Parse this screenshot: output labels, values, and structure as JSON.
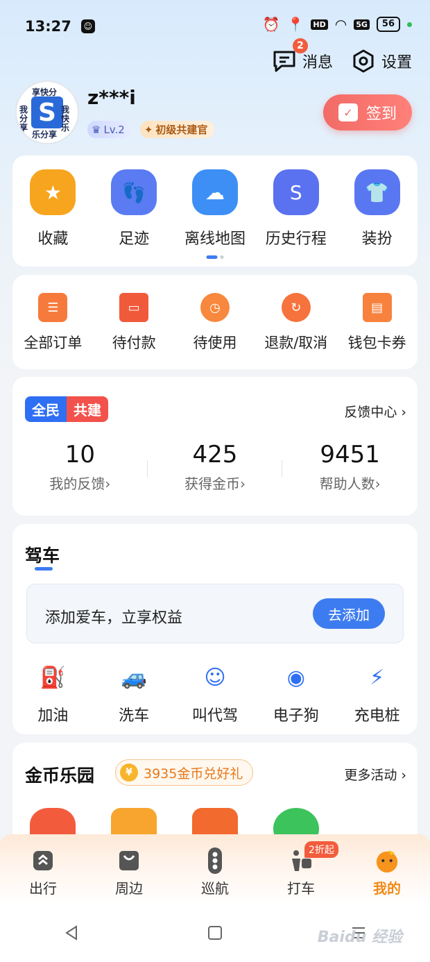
{
  "status": {
    "time": "13:27",
    "battery": "56",
    "network": "5G",
    "hd": "HD"
  },
  "header": {
    "messages_label": "消息",
    "messages_badge": "2",
    "settings_label": "设置"
  },
  "profile": {
    "username": "z***i",
    "level": "Lv.2",
    "title_badge": "初级共建官",
    "signin_label": "签到",
    "avatar_text": [
      "享快分",
      "我分享",
      "我快乐",
      "乐分享"
    ]
  },
  "quick": [
    {
      "label": "收藏",
      "icon": "star-icon",
      "color": "#f7a51e"
    },
    {
      "label": "足迹",
      "icon": "footprint-icon",
      "color": "#5b7bf2"
    },
    {
      "label": "离线地图",
      "icon": "cloud-download-icon",
      "color": "#3d8ff5"
    },
    {
      "label": "历史行程",
      "icon": "route-icon",
      "color": "#5a72f0"
    },
    {
      "label": "装扮",
      "icon": "tshirt-icon",
      "color": "#5a77f2"
    }
  ],
  "orders": [
    {
      "label": "全部订单",
      "icon": "order-list-icon"
    },
    {
      "label": "待付款",
      "icon": "wallet-pay-icon"
    },
    {
      "label": "待使用",
      "icon": "clock-icon"
    },
    {
      "label": "退款/取消",
      "icon": "refund-icon"
    },
    {
      "label": "钱包卡券",
      "icon": "card-coupon-icon"
    }
  ],
  "feedback": {
    "tag_a": "全民",
    "tag_b": "共建",
    "center_label": "反馈中心 ›",
    "stats": [
      {
        "value": "10",
        "label": "我的反馈›"
      },
      {
        "value": "425",
        "label": "获得金币›"
      },
      {
        "value": "9451",
        "label": "帮助人数›"
      }
    ]
  },
  "drive": {
    "title": "驾车",
    "add_car_text": "添加爱车，立享权益",
    "add_car_button": "去添加",
    "items": [
      {
        "label": "加油",
        "icon": "gas-pump-icon"
      },
      {
        "label": "洗车",
        "icon": "car-wash-icon"
      },
      {
        "label": "叫代驾",
        "icon": "driver-icon"
      },
      {
        "label": "电子狗",
        "icon": "camera-radar-icon"
      },
      {
        "label": "充电桩",
        "icon": "charger-icon"
      }
    ]
  },
  "coins": {
    "title": "金币乐园",
    "pill_text": "3935金币兑好礼",
    "more_label": "更多活动 ›"
  },
  "tabs": [
    {
      "label": "出行",
      "icon": "travel-icon"
    },
    {
      "label": "周边",
      "icon": "nearby-bag-icon"
    },
    {
      "label": "巡航",
      "icon": "traffic-light-icon"
    },
    {
      "label": "打车",
      "icon": "taxi-icon",
      "badge": "2折起"
    },
    {
      "label": "我的",
      "icon": "mine-face-icon",
      "active": true
    }
  ],
  "watermark": "Baidu 经验"
}
